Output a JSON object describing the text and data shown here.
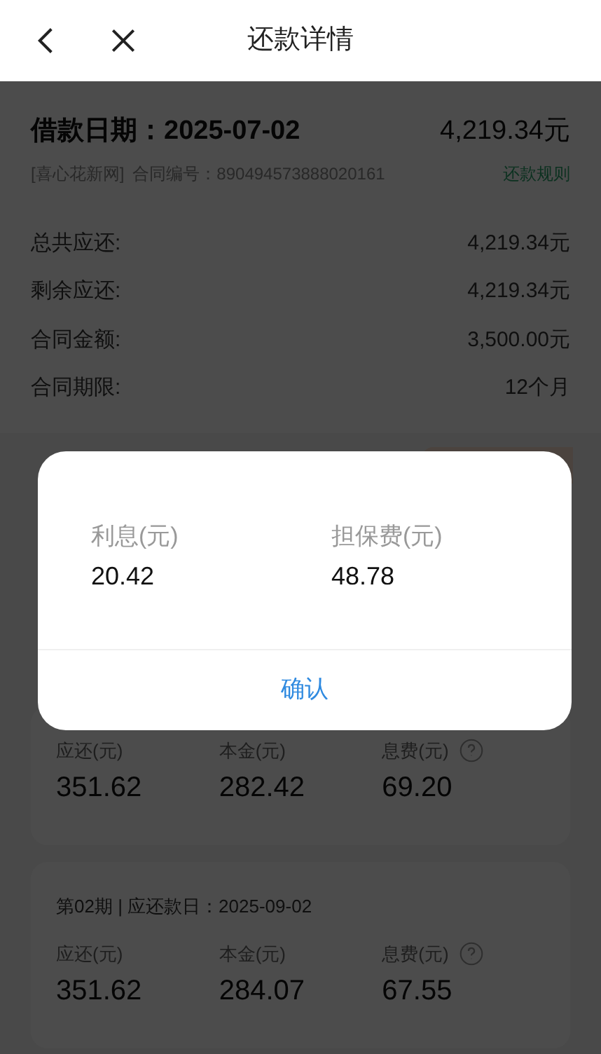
{
  "header": {
    "title": "还款详情"
  },
  "loan": {
    "date": "借款日期：2025-07-02",
    "amount": "4,219.34元",
    "source": "[喜心花新网]",
    "contract": "合同编号：890494573888020161",
    "rule_link": "还款规则"
  },
  "details": [
    {
      "label": "总共应还:",
      "value": "4,219.34元"
    },
    {
      "label": "剩余应还:",
      "value": "4,219.34元"
    },
    {
      "label": "合同金额:",
      "value": "3,500.00元"
    },
    {
      "label": "合同期限:",
      "value": "12个月"
    }
  ],
  "installments": [
    {
      "items": [
        {
          "label": "应还(元)",
          "value": "351.62",
          "help": false
        },
        {
          "label": "本金(元)",
          "value": "282.42",
          "help": false
        },
        {
          "label": "息费(元)",
          "value": "69.20",
          "help": true
        }
      ]
    },
    {
      "heading": "第02期 | 应还款日：2025-09-02",
      "items": [
        {
          "label": "应还(元)",
          "value": "351.62",
          "help": false
        },
        {
          "label": "本金(元)",
          "value": "284.07",
          "help": false
        },
        {
          "label": "息费(元)",
          "value": "67.55",
          "help": true
        }
      ]
    }
  ],
  "dialog": {
    "items": [
      {
        "label": "利息(元)",
        "value": "20.42"
      },
      {
        "label": "担保费(元)",
        "value": "48.78"
      }
    ],
    "confirm": "确认"
  }
}
